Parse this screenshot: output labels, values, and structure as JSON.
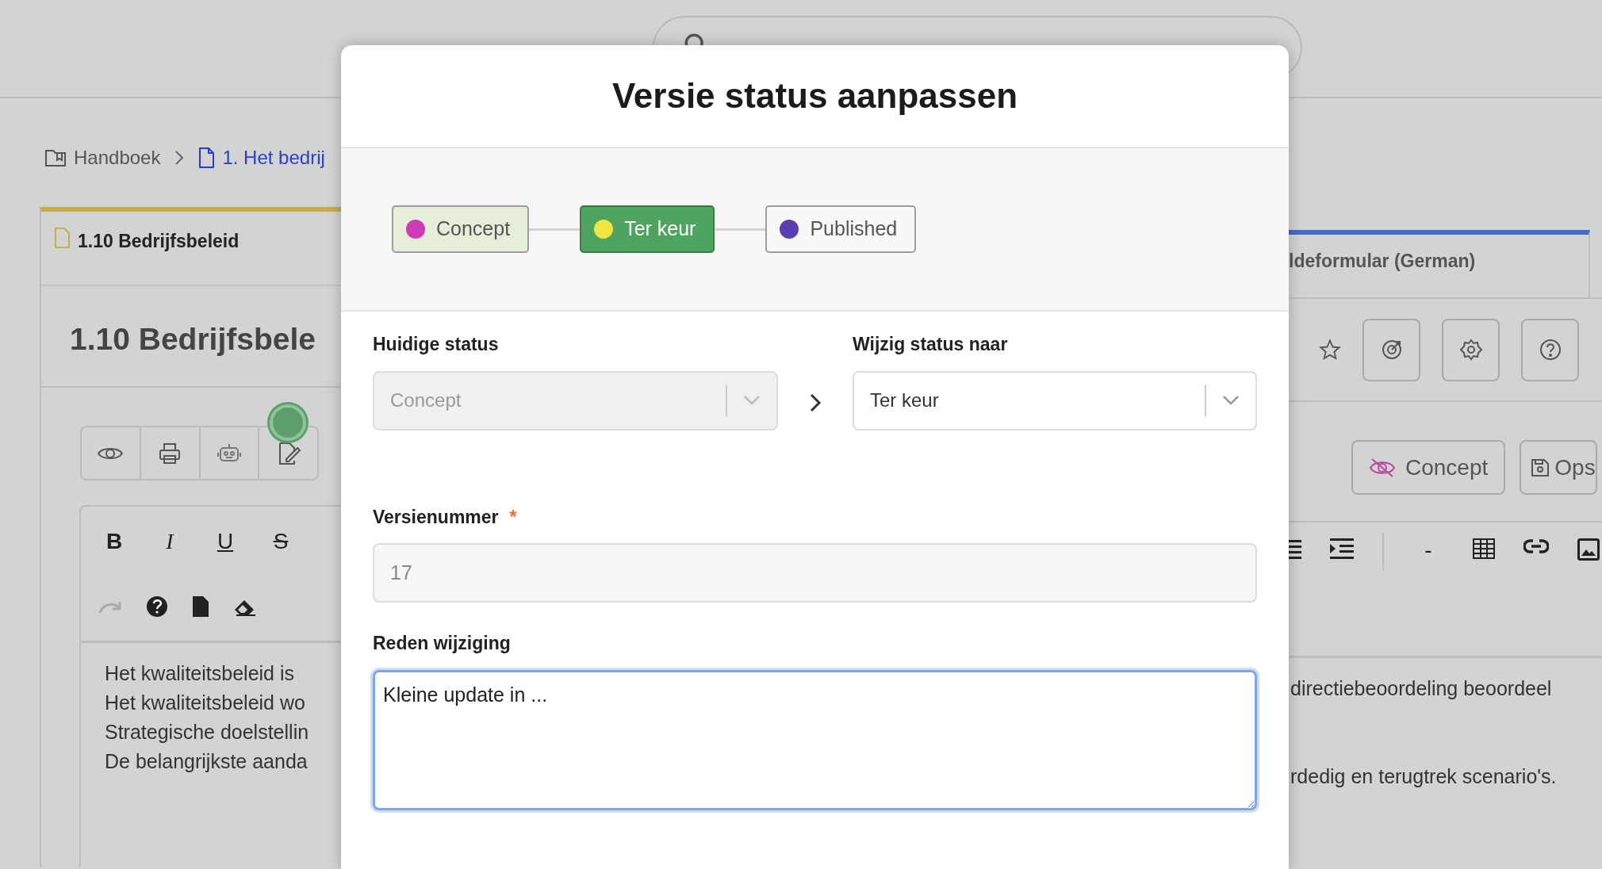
{
  "breadcrumb": [
    {
      "label": "Handboek",
      "kind": "book"
    },
    {
      "label": "1. Het bedrij",
      "kind": "document"
    }
  ],
  "document": {
    "tab": "1.10 Bedrijfsbeleid",
    "title": "1.10 Bedrijfsbele",
    "other_tab": "ldeformular (German)",
    "status_button": "Concept",
    "save_button": "Ops",
    "format_buttons": [
      {
        "label": "B",
        "kind": "bold"
      },
      {
        "label": "I",
        "kind": "italic"
      },
      {
        "label": "U",
        "kind": "underline"
      },
      {
        "label": "S",
        "kind": "strike"
      }
    ],
    "rule_button": "-",
    "body_lines": [
      {
        "left": "Het kwaliteitsbeleid is",
        "right": "directiebeoordeling beoordeel"
      },
      {
        "left": "Het kwaliteitsbeleid wo"
      },
      {
        "left": "Strategische doelstellin"
      },
      {
        "left": "De belangrijkste aanda",
        "right": "rdedig en terugtrek scenario's."
      }
    ]
  },
  "modal": {
    "title": "Versie status aanpassen",
    "steps": [
      {
        "label": "Concept",
        "color": "#cf3bb5",
        "completed": true,
        "selected": false
      },
      {
        "label": "Ter keur",
        "color": "#f2e443",
        "completed": false,
        "selected": true
      },
      {
        "label": "Published",
        "color": "#5b3eb0",
        "completed": false,
        "selected": false
      }
    ],
    "current_status": {
      "label": "Huidige status",
      "value": "Concept",
      "disabled": true
    },
    "new_status": {
      "label": "Wijzig status naar",
      "value": "Ter keur",
      "disabled": false
    },
    "version": {
      "label": "Versienummer",
      "required_mark": "*",
      "value": "17",
      "disabled": true
    },
    "reason": {
      "label": "Reden wijziging",
      "value": "Kleine update in ...",
      "focused": true
    }
  }
}
